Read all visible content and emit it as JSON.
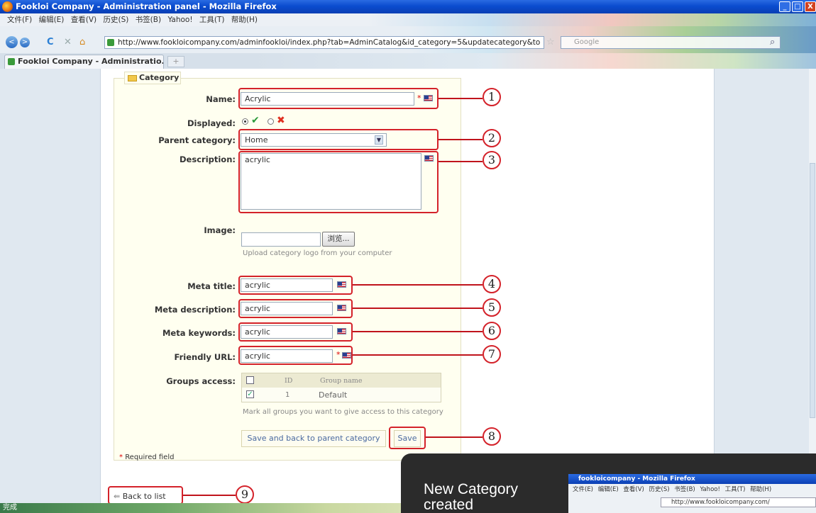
{
  "window": {
    "title": "Fookloi Company - Administration panel - Mozilla Firefox",
    "min": "_",
    "max": "□",
    "close": "X"
  },
  "menu": {
    "items": [
      "文件(F)",
      "编辑(E)",
      "查看(V)",
      "历史(S)",
      "书签(B)",
      "Yahoo!",
      "工具(T)",
      "帮助(H)"
    ]
  },
  "nav": {
    "back": "<",
    "forward": ">",
    "url": "http://www.fookloicompany.com/adminfookloi/index.php?tab=AdminCatalog&id_category=5&updatecategory&to",
    "search_placeholder": "Google"
  },
  "tab": {
    "label": "Fookloi Company - Administratio...",
    "new_tab": "+"
  },
  "form": {
    "legend": "Category",
    "name_label": "Name:",
    "name_value": "Acrylic",
    "displayed_label": "Displayed:",
    "parent_label": "Parent category:",
    "parent_value": "Home",
    "description_label": "Description:",
    "description_value": "acrylic",
    "image_label": "Image:",
    "browse_label": "浏览...",
    "image_hint": "Upload category logo from your computer",
    "meta_title_label": "Meta title:",
    "meta_title_value": "acrylic",
    "meta_description_label": "Meta description:",
    "meta_description_value": "acrylic",
    "meta_keywords_label": "Meta keywords:",
    "meta_keywords_value": "acrylic",
    "friendly_url_label": "Friendly URL:",
    "friendly_url_value": "acrylic",
    "groups_label": "Groups access:",
    "groups_header": {
      "id": "ID",
      "name": "Group name"
    },
    "groups_rows": [
      {
        "id": "1",
        "name": "Default",
        "checked": true
      }
    ],
    "groups_hint": "Mark all groups you want to give access to this category",
    "save_back_label": "Save and back to parent category",
    "save_label": "Save",
    "required_star": "*",
    "required_text": "Required field",
    "back_label": "Back to list"
  },
  "callouts": [
    "1",
    "2",
    "3",
    "4",
    "5",
    "6",
    "7",
    "8",
    "9"
  ],
  "statusbar": {
    "text": "完成"
  },
  "overlay": {
    "caption": "New Category created"
  },
  "mini_browser": {
    "title": "fookloicompany - Mozilla Firefox",
    "menu": "文件(E) 编辑(E) 查看(V) 历史(S) 书签(B) Yahoo! 工具(T) 帮助(H)",
    "url": "http://www.fookloicompany.com/"
  },
  "colors": {
    "accent_red": "#d4222a",
    "title_blue": "#0a4ccf",
    "check_green": "#2a9a3a",
    "cross_red": "#e03020"
  }
}
